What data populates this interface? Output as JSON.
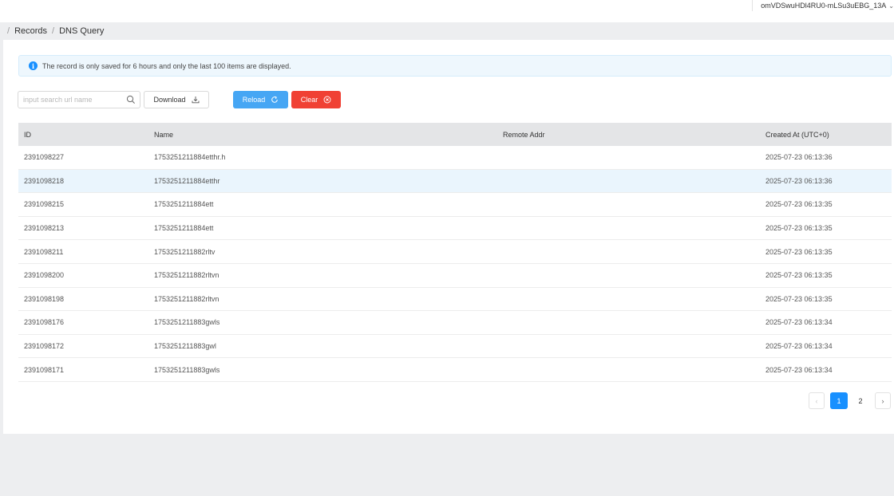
{
  "header": {
    "user_label": "omVDSwuHDl4RU0-mLSu3uEBG_13A"
  },
  "breadcrumb": {
    "items": [
      "Records",
      "DNS Query"
    ]
  },
  "alert": {
    "text": "The record is only saved for 6 hours and only the last 100 items are displayed."
  },
  "toolbar": {
    "search_placeholder": "input search url name",
    "download_label": "Download",
    "reload_label": "Reload",
    "clear_label": "Clear"
  },
  "table": {
    "columns": [
      "ID",
      "Name",
      "Remote Addr",
      "Created At (UTC+0)"
    ],
    "rows": [
      {
        "id": "2391098227",
        "name": "1753251211884etthr.h",
        "addr": "",
        "created": "2025-07-23 06:13:36"
      },
      {
        "id": "2391098218",
        "name": "1753251211884etthr",
        "addr": "",
        "created": "2025-07-23 06:13:36"
      },
      {
        "id": "2391098215",
        "name": "1753251211884ett",
        "addr": "",
        "created": "2025-07-23 06:13:35"
      },
      {
        "id": "2391098213",
        "name": "1753251211884ett",
        "addr": "",
        "created": "2025-07-23 06:13:35"
      },
      {
        "id": "2391098211",
        "name": "1753251211882rltv",
        "addr": "",
        "created": "2025-07-23 06:13:35"
      },
      {
        "id": "2391098200",
        "name": "1753251211882rltvn",
        "addr": "",
        "created": "2025-07-23 06:13:35"
      },
      {
        "id": "2391098198",
        "name": "1753251211882rltvn",
        "addr": "",
        "created": "2025-07-23 06:13:35"
      },
      {
        "id": "2391098176",
        "name": "1753251211883gwls",
        "addr": "",
        "created": "2025-07-23 06:13:34"
      },
      {
        "id": "2391098172",
        "name": "1753251211883gwl",
        "addr": "",
        "created": "2025-07-23 06:13:34"
      },
      {
        "id": "2391098171",
        "name": "1753251211883gwls",
        "addr": "",
        "created": "2025-07-23 06:13:34"
      }
    ],
    "highlighted_row": 1
  },
  "pagination": {
    "prev": "‹",
    "pages": [
      "1",
      "2"
    ],
    "current": "1",
    "next": "›"
  },
  "colors": {
    "accent": "#1890ff",
    "reload": "#46a6f4",
    "clear": "#f04134",
    "alert_bg": "#eef7fd"
  },
  "icons": {
    "alert": "info-icon",
    "search": "search-icon",
    "download": "download-icon",
    "reload": "reload-icon",
    "clear": "close-circle-icon",
    "user_menu": "chevron-down-icon"
  }
}
